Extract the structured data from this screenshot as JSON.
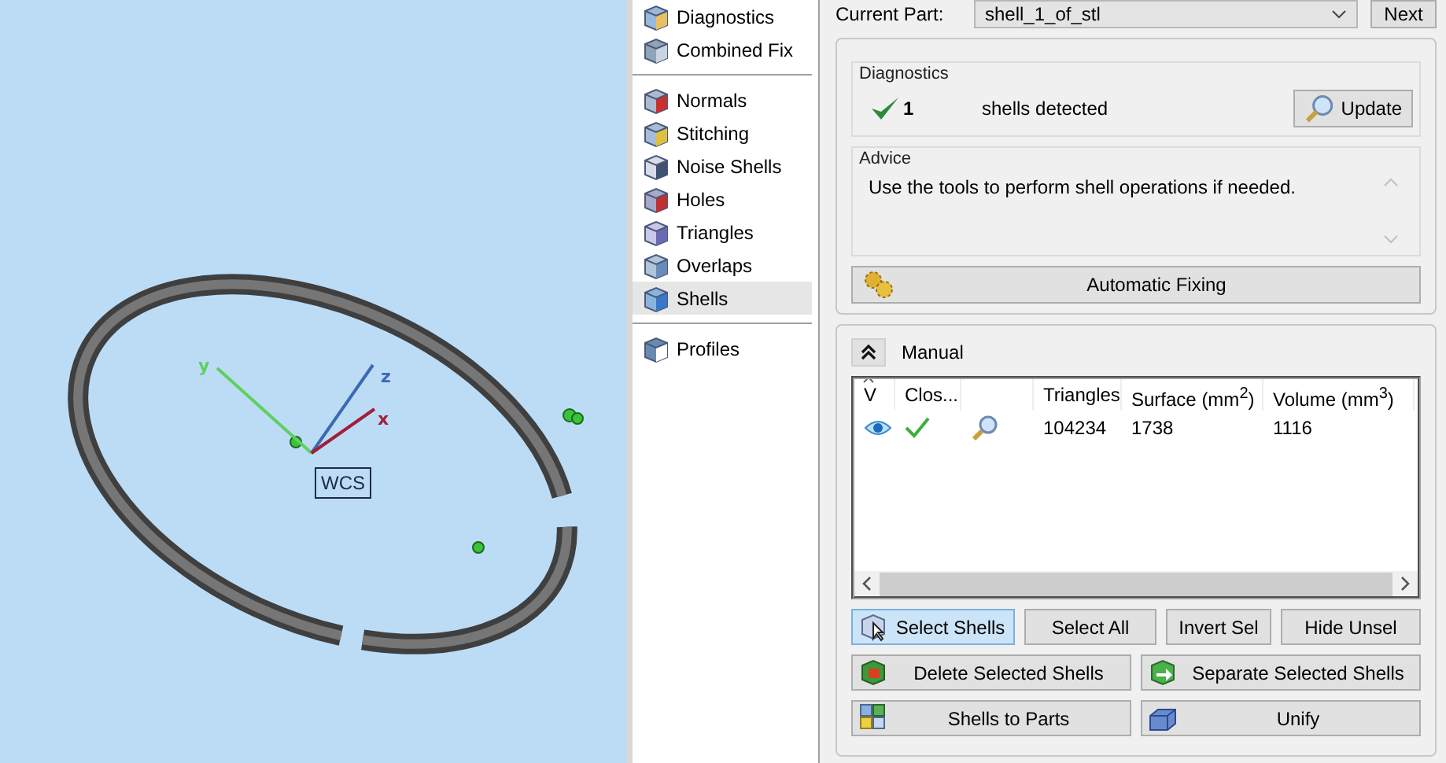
{
  "viewport": {
    "origin_label": "WCS",
    "axes": [
      {
        "kind": "y",
        "label": "y"
      },
      {
        "kind": "z",
        "label": "z"
      },
      {
        "kind": "x",
        "label": "x"
      }
    ]
  },
  "sidebar": {
    "groups": [
      [
        {
          "label": "Diagnostics",
          "selected": false
        },
        {
          "label": "Combined Fix",
          "selected": false
        }
      ],
      [
        {
          "label": "Normals",
          "selected": false
        },
        {
          "label": "Stitching",
          "selected": false
        },
        {
          "label": "Noise Shells",
          "selected": false
        },
        {
          "label": "Holes",
          "selected": false
        },
        {
          "label": "Triangles",
          "selected": false
        },
        {
          "label": "Overlaps",
          "selected": false
        },
        {
          "label": "Shells",
          "selected": true
        }
      ],
      [
        {
          "label": "Profiles",
          "selected": false
        }
      ]
    ]
  },
  "part_selector": {
    "label": "Current Part:",
    "value": "shell_1_of_stl",
    "next_button": "Next"
  },
  "diagnostics": {
    "title": "Diagnostics",
    "ok": true,
    "count": "1",
    "text": "shells detected",
    "update_button": "Update"
  },
  "advice": {
    "title": "Advice",
    "text": "Use the tools to perform shell operations if needed."
  },
  "auto_fix_button": "Automatic Fixing",
  "manual": {
    "label": "Manual",
    "expanded": true,
    "table": {
      "columns": [
        {
          "kind": "text",
          "label": "V",
          "sorted": true
        },
        {
          "kind": "text",
          "label": "Clos...",
          "sorted": false
        },
        {
          "kind": "blank",
          "sorted": false
        },
        {
          "kind": "text",
          "label": "Triangles",
          "sorted": false
        },
        {
          "kind": "text",
          "label": "Surface (mm$^{2}$)",
          "sorted": false
        },
        {
          "kind": "text",
          "label": "Volume (mm$^{3}$)",
          "sorted": false
        }
      ],
      "rows": [
        {
          "visible": true,
          "closed": true,
          "triangles": "104234",
          "surface": "1738",
          "volume": "1116"
        }
      ]
    },
    "buttons": [
      [
        {
          "label": "Select Shells",
          "pressed": true
        },
        {
          "label": "Select All",
          "pressed": false
        },
        {
          "label": "Invert Sel",
          "pressed": false
        },
        {
          "label": "Hide Unsel",
          "pressed": false
        }
      ],
      [
        {
          "label": "Delete Selected Shells",
          "pressed": false
        },
        {
          "label": "Separate Selected Shells",
          "pressed": false
        }
      ],
      [
        {
          "label": "Shells to Parts",
          "pressed": false
        },
        {
          "label": "Unify",
          "pressed": false
        }
      ]
    ]
  }
}
